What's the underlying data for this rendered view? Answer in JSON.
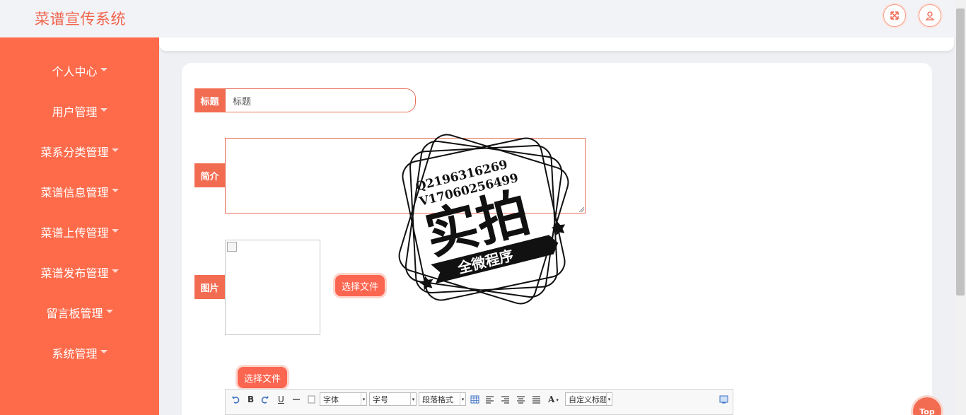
{
  "header": {
    "brand": "菜谱宣传系统",
    "fullscreen_icon": "expand-arrows-icon",
    "user_icon": "user-icon"
  },
  "sidebar": {
    "items": [
      {
        "label": "个人中心"
      },
      {
        "label": "用户管理"
      },
      {
        "label": "菜系分类管理"
      },
      {
        "label": "菜谱信息管理"
      },
      {
        "label": "菜谱上传管理"
      },
      {
        "label": "菜谱发布管理"
      },
      {
        "label": "留言板管理"
      },
      {
        "label": "系统管理"
      }
    ]
  },
  "form": {
    "title_label": "标题",
    "title_placeholder": "标题",
    "intro_label": "简介",
    "image_label": "图片",
    "choose_file": "选择文件",
    "choose_file_2": "选择文件"
  },
  "editor": {
    "font_select": "字体",
    "size_select": "字号",
    "paragraph_select": "段落格式",
    "custom_title_select": "自定义标题",
    "bold": "B",
    "underline": "U",
    "font_color": "A"
  },
  "stamp": {
    "line1": "Q2196316269",
    "line2": "V17060256499",
    "big": "实拍",
    "ribbon": "全微程序"
  },
  "back_to_top": "Top",
  "colors": {
    "accent": "#fe6b4b",
    "brand_text": "#f0644b"
  }
}
